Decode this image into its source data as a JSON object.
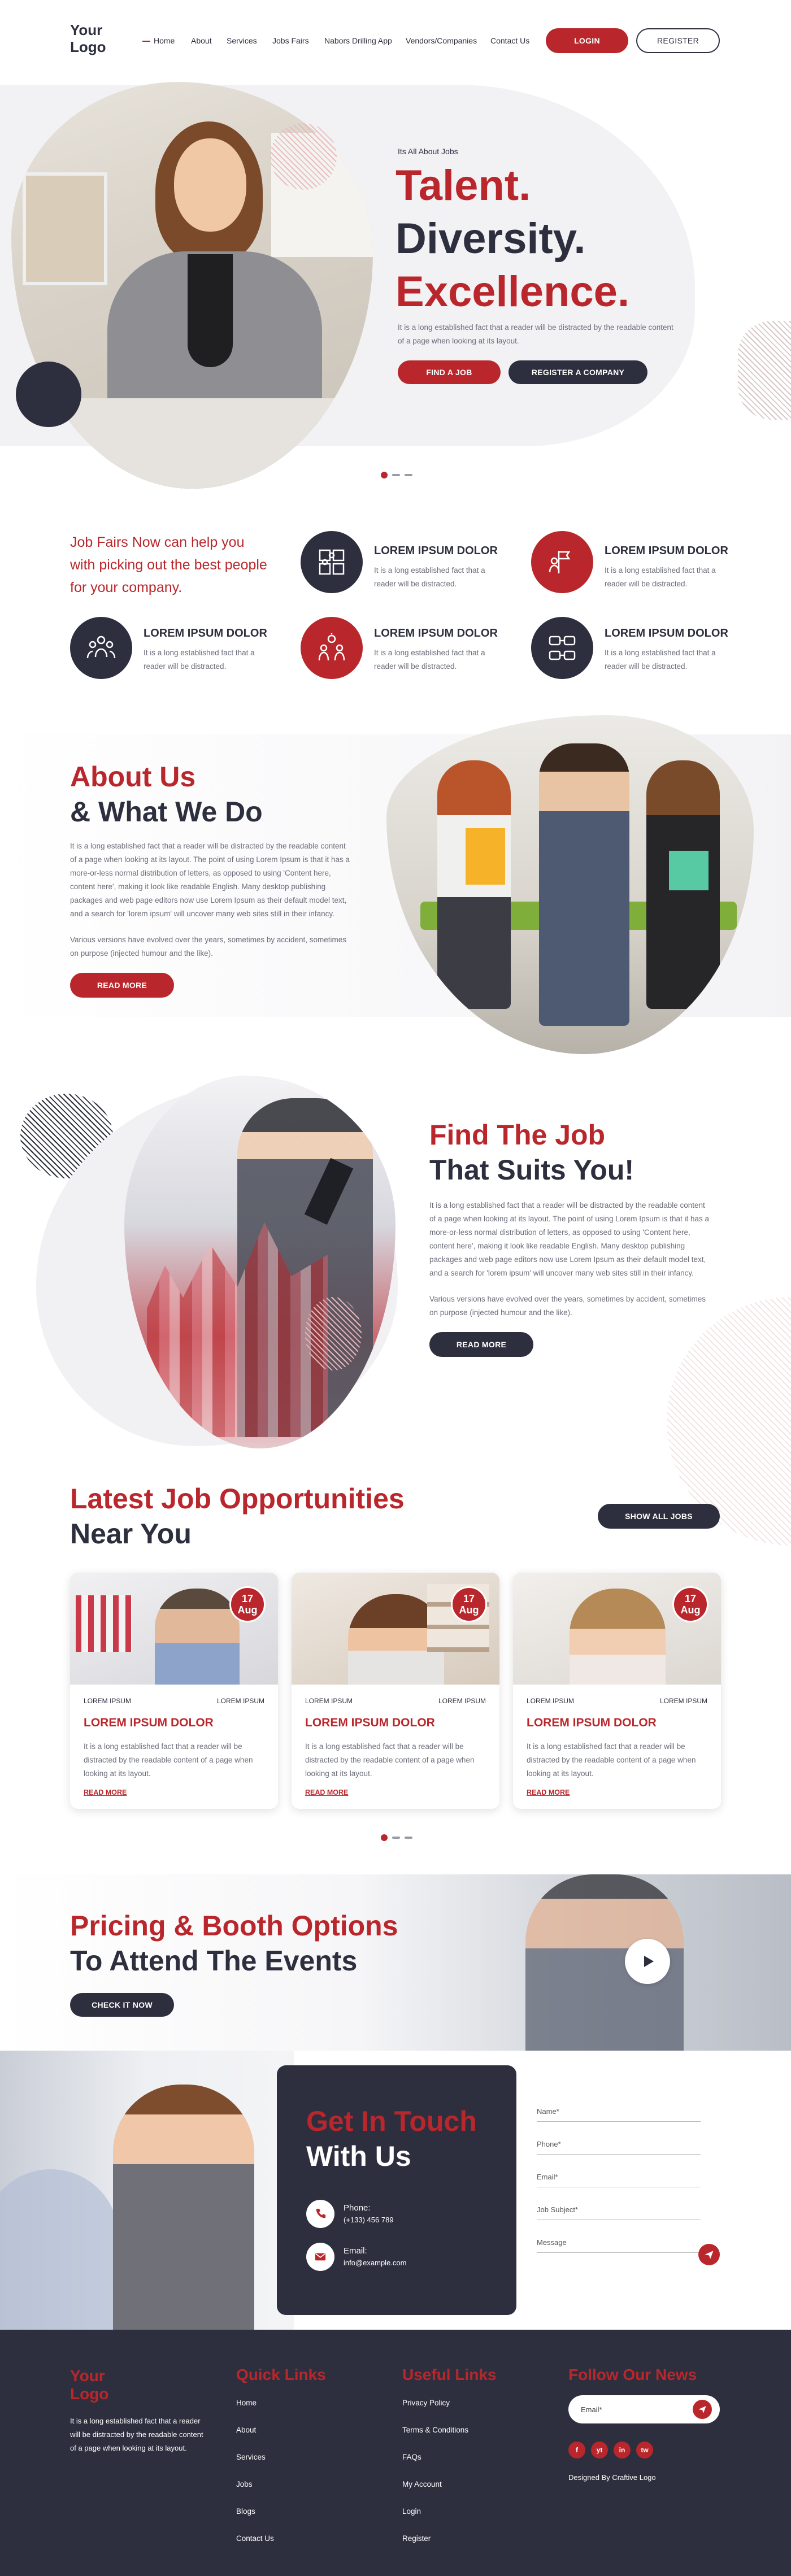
{
  "header": {
    "logo_line1": "Your",
    "logo_line2": "Logo",
    "nav": [
      "Home",
      "About",
      "Services",
      "Jobs Fairs",
      "Nabors Drilling App",
      "Vendors/Companies",
      "Contact Us"
    ],
    "login": "LOGIN",
    "register": "REGISTER"
  },
  "hero": {
    "eyebrow": "Its All About Jobs",
    "line1": "Talent.",
    "line2": "Diversity.",
    "line3": "Excellence.",
    "text": "It is a long established fact that a reader will be distracted by the readable content of a page when looking at its layout.",
    "btn_find": "FIND A JOB",
    "btn_register": "REGISTER A COMPANY"
  },
  "features": {
    "intro": "Job Fairs Now can help you with picking out the best people for your company.",
    "items": [
      {
        "title": "LOREM IPSUM DOLOR",
        "text": "It is a long established fact that a reader will be distracted.",
        "icon": "puzzle-icon"
      },
      {
        "title": "LOREM IPSUM DOLOR",
        "text": "It is a long established fact that a reader will be distracted.",
        "icon": "flag-person-icon"
      },
      {
        "title": "LOREM IPSUM DOLOR",
        "text": "It is a long established fact that a reader will be distracted.",
        "icon": "team-icon"
      },
      {
        "title": "LOREM IPSUM DOLOR",
        "text": "It is a long established fact that a reader will be distracted.",
        "icon": "group-idea-icon"
      },
      {
        "title": "LOREM IPSUM DOLOR",
        "text": "It is a long established fact that a reader will be distracted.",
        "icon": "network-icon"
      }
    ]
  },
  "about": {
    "title1": "About Us",
    "title2": "& What We Do",
    "p1": "It is a long established fact that a reader will be distracted by the readable content of a page when looking at its layout. The point of using Lorem Ipsum is that it has a more-or-less normal distribution of letters, as opposed to using 'Content here, content here', making it look like readable English. Many desktop publishing packages and web page editors now use Lorem Ipsum as their default model text, and a search for 'lorem ipsum' will uncover many web sites still in their infancy.",
    "p2": "Various versions have evolved over the years, sometimes by accident, sometimes on purpose (injected humour and the like).",
    "btn": "READ MORE"
  },
  "findjob": {
    "title1": "Find The Job",
    "title2": "That Suits You!",
    "p1": "It is a long established fact that a reader will be distracted by the readable content of a page when looking at its layout. The point of using Lorem Ipsum is that it has a more-or-less normal distribution of letters, as opposed to using 'Content here, content here', making it look like readable English. Many desktop publishing packages and web page editors now use Lorem Ipsum as their default model text, and a search for 'lorem ipsum' will uncover many web sites still in their infancy.",
    "p2": "Various versions have evolved over the years, sometimes by accident, sometimes on purpose (injected humour and the like).",
    "btn": "READ MORE"
  },
  "jobs": {
    "title1": "Latest Job Opportunities",
    "title2": "Near You",
    "btn": "SHOW ALL JOBS",
    "cards": [
      {
        "day": "17",
        "month": "Aug",
        "meta_left": "LOREM IPSUM",
        "meta_right": "LOREM IPSUM",
        "title": "LOREM IPSUM DOLOR",
        "text": "It is a long established fact that a reader will be distracted by the readable content of a page when looking at its layout.",
        "more": "READ MORE"
      },
      {
        "day": "17",
        "month": "Aug",
        "meta_left": "LOREM IPSUM",
        "meta_right": "LOREM IPSUM",
        "title": "LOREM IPSUM DOLOR",
        "text": "It is a long established fact that a reader will be distracted by the readable content of a page when looking at its layout.",
        "more": "READ MORE"
      },
      {
        "day": "17",
        "month": "Aug",
        "meta_left": "LOREM IPSUM",
        "meta_right": "LOREM IPSUM",
        "title": "LOREM IPSUM DOLOR",
        "text": "It is a long established fact that a reader will be distracted by the readable content of a page when looking at its layout.",
        "more": "READ MORE"
      }
    ]
  },
  "pricing": {
    "title1": "Pricing & Booth Options",
    "title2": "To Attend The Events",
    "btn": "CHECK IT NOW"
  },
  "contact": {
    "title1": "Get In Touch",
    "title2": "With Us",
    "phone_label": "Phone:",
    "phone": "(+133) 456 789",
    "email_label": "Email:",
    "email": "info@example.com",
    "fields": [
      "Name*",
      "Phone*",
      "Email*",
      "Job Subject*",
      "Message"
    ]
  },
  "footer": {
    "logo_line1": "Your",
    "logo_line2": "Logo",
    "about": "It is a long established fact that a reader will be distracted by the readable content of a page when looking at its layout.",
    "quick_title": "Quick Links",
    "quick": [
      "Home",
      "About",
      "Services",
      "Jobs",
      "Blogs",
      "Contact Us"
    ],
    "useful_title": "Useful Links",
    "useful": [
      "Privacy Policy",
      "Terms & Conditions",
      "FAQs",
      "My Account",
      "Login",
      "Register"
    ],
    "follow_title": "Follow Our News",
    "email_placeholder": "Email*",
    "social": [
      "f",
      "yt",
      "in",
      "tw"
    ],
    "credit": "Designed By Craftive Logo"
  },
  "colors": {
    "primary": "#b9272c",
    "dark": "#2e2f3e"
  }
}
